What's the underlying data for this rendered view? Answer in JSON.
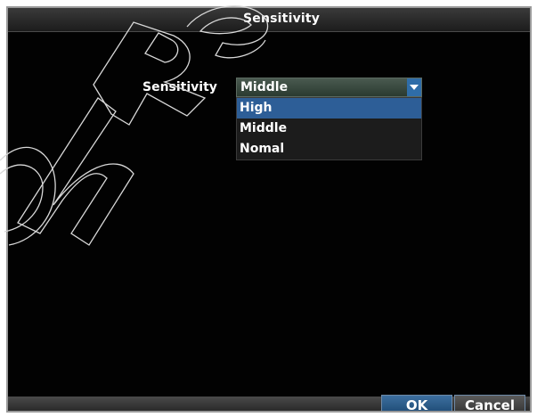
{
  "dialog": {
    "title": "Sensitivity"
  },
  "form": {
    "label": "Sensitivity",
    "selected_value": "Middle",
    "options": [
      "High",
      "Middle",
      "Nomal"
    ],
    "highlighted_option": "High"
  },
  "buttons": {
    "ok": "OK",
    "cancel": "Cancel"
  },
  "colors": {
    "background": "#020202",
    "highlight": "#2d5e97",
    "ok_button": "#2d5e97"
  },
  "icons": {
    "dropdown": "chevron-down-icon"
  }
}
